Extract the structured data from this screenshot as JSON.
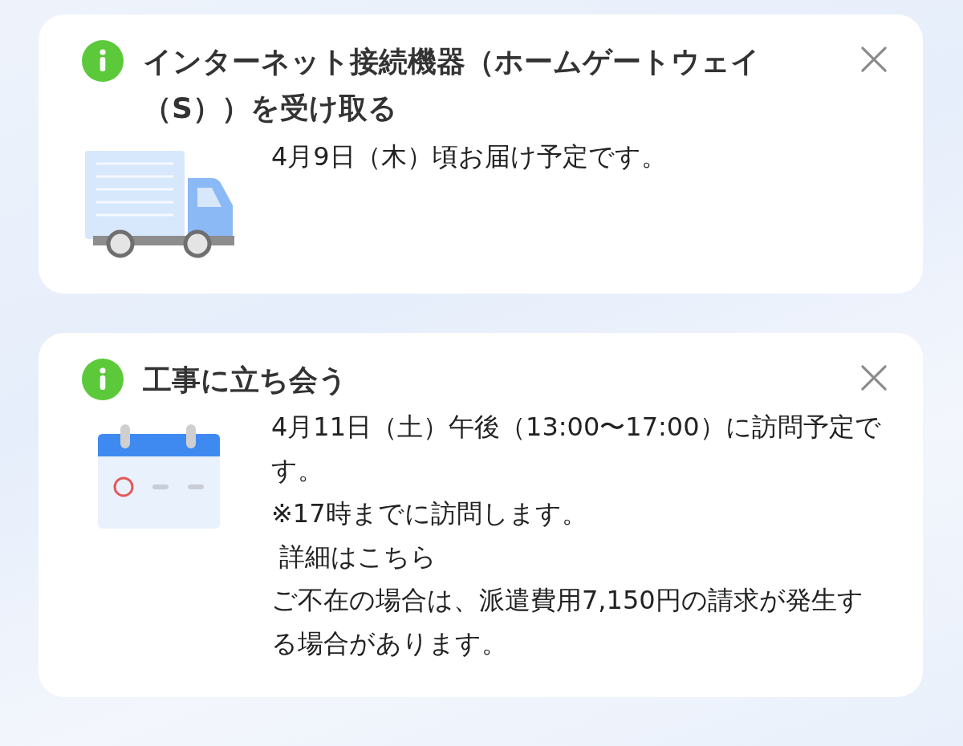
{
  "cards": [
    {
      "kind": "delivery",
      "title": "インターネット接続機器（ホームゲートウェイ（S））を受け取る",
      "paragraphs": [
        "4月9日（木）頃お届け予定です。"
      ]
    },
    {
      "kind": "visit",
      "title": "工事に立ち会う",
      "paragraphs": [
        "4月11日（土）午後（13:00〜17:00）に訪問予定です。",
        "※17時までに訪問します。",
        " 詳細はこちら",
        "ご不在の場合は、派遣費用7,150円の請求が発生する場合があります。"
      ]
    }
  ]
}
